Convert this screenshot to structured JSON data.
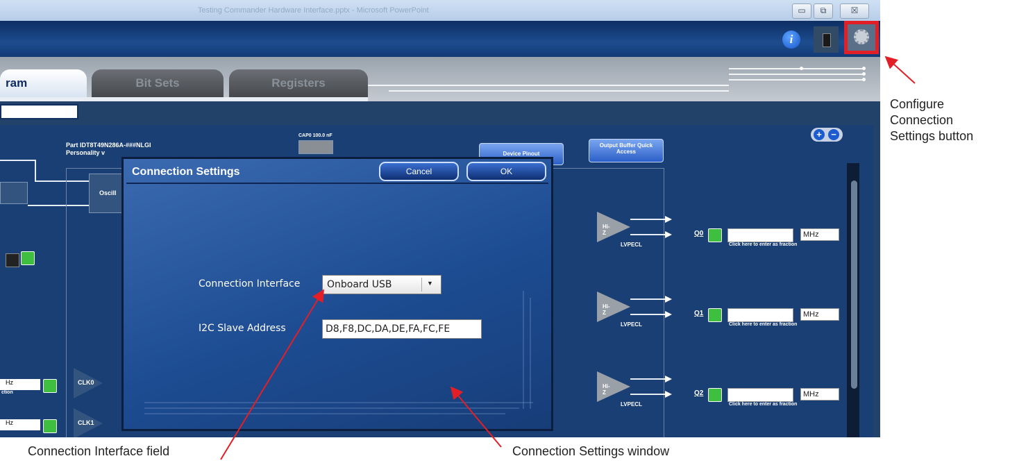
{
  "window": {
    "title": "Testing Commander Hardware Interface.pptx - Microsoft PowerPoint",
    "minimize_label": "▭",
    "maximize_label": "⧉",
    "close_label": "☒"
  },
  "header": {
    "info_label": "i"
  },
  "tabs": [
    {
      "label": "ram"
    },
    {
      "label": "Bit Sets"
    },
    {
      "label": "Registers"
    }
  ],
  "diagram": {
    "part_line1": "Part IDT8T49N286A-###NLGI",
    "part_line2": "Personality v",
    "cap_label": "CAP0 100.0 nF",
    "device_pinout_label": "Device Pinout",
    "output_buffer_label": "Output Buffer Quick Access",
    "oscillator_label": "Oscill",
    "clk0_label": "CLK0",
    "clk1_label": "CLK1",
    "left_unit_1": "Hz",
    "left_unit_2": "Hz",
    "left_hint": "ction",
    "zoom_in": "+",
    "zoom_out": "−",
    "outputs": [
      {
        "name": "Q0",
        "unit": "MHz",
        "hint": "Click here to enter as fraction",
        "buffer": "Hi-Z",
        "type": "LVPECL"
      },
      {
        "name": "Q1",
        "unit": "MHz",
        "hint": "Click here to enter as fraction",
        "buffer": "Hi-Z",
        "type": "LVPECL"
      },
      {
        "name": "Q2",
        "unit": "MHz",
        "hint": "Click here to enter as fraction",
        "buffer": "Hi-Z",
        "type": "LVPECL"
      }
    ]
  },
  "dialog": {
    "title": "Connection Settings",
    "cancel_label": "Cancel",
    "ok_label": "OK",
    "interface_label": "Connection Interface",
    "interface_value": "Onboard USB",
    "address_label": "I2C Slave Address",
    "address_value": "D8,F8,DC,DA,DE,FA,FC,FE"
  },
  "callouts": {
    "configure": [
      "Configure",
      "Connection",
      "Settings button"
    ],
    "interface_field": "Connection Interface field",
    "settings_window": "Connection Settings window"
  },
  "colors": {
    "highlight": "#e21f26",
    "app_header": "#1d4c8e",
    "dialog": "#1d4c92"
  }
}
